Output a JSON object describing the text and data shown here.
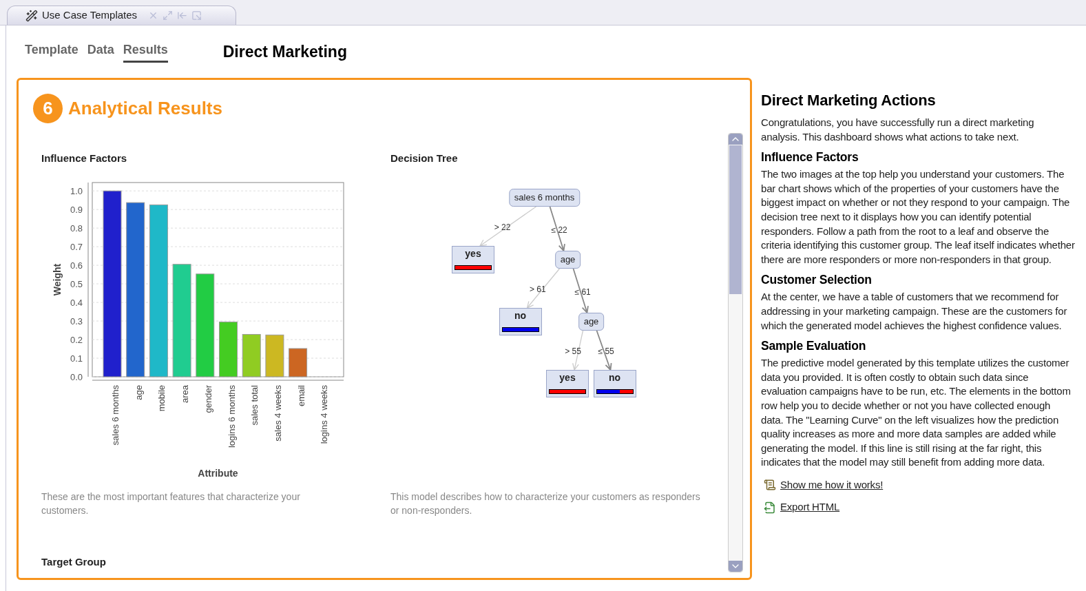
{
  "tab": {
    "title": "Use Case Templates"
  },
  "nav": [
    {
      "label": "Template",
      "selected": false
    },
    {
      "label": "Data",
      "selected": false
    },
    {
      "label": "Results",
      "selected": true
    }
  ],
  "page_title": "Direct Marketing",
  "results": {
    "step": "6",
    "title": "Analytical Results",
    "influence_factors": {
      "title": "Influence Factors",
      "caption": "These are the most important features that characterize your customers.",
      "chart_data": {
        "type": "bar",
        "xlabel": "Attribute",
        "ylabel": "Weight",
        "categories": [
          "sales 6 months",
          "age",
          "mobile",
          "area",
          "gender",
          "logins 6 months",
          "sales total",
          "sales 4 weeks",
          "email",
          "logins 4 weeks"
        ],
        "grid": true,
        "series": [
          {
            "values": [
              1.0,
              0.937,
              0.925,
              0.605,
              0.553,
              0.295,
              0.228,
              0.225,
              0.152,
              0.0
            ]
          }
        ],
        "colors": [
          "#2020cc",
          "#2266cc",
          "#1fb8c8",
          "#20cc90",
          "#22cc44",
          "#44cc22",
          "#90cc22",
          "#ccb822",
          "#cc6622"
        ],
        "ylim": [
          0,
          1.045
        ],
        "yticks": [
          {
            "value": 0,
            "label": "0.0"
          },
          {
            "value": 0.1,
            "label": "0.1"
          },
          {
            "value": 0.2,
            "label": "0.2"
          },
          {
            "value": 0.3,
            "label": "0.3"
          },
          {
            "value": 0.4,
            "label": "0.4"
          },
          {
            "value": 0.5,
            "label": "0.5"
          },
          {
            "value": 0.6,
            "label": "0.6"
          },
          {
            "value": 0.7,
            "label": "0.7"
          },
          {
            "value": 0.8,
            "label": "0.8"
          },
          {
            "value": 0.9,
            "label": "0.9"
          },
          {
            "value": 1.0,
            "label": "1.0"
          }
        ]
      }
    },
    "decision_tree": {
      "title": "Decision Tree",
      "caption": "This model describes how to characterize your customers as responders or non-responders.",
      "root": {
        "kind": "split",
        "label": "sales 6 months",
        "children": [
          {
            "edge": "> 22",
            "kind": "leaf",
            "label": "yes",
            "level": 0
          },
          {
            "edge": "≤ 22",
            "kind": "split",
            "label": "age",
            "children": [
              {
                "edge": "> 61",
                "kind": "leaf",
                "label": "no",
                "level": 1
              },
              {
                "edge": "≤ 61",
                "kind": "split",
                "label": "age",
                "children": [
                  {
                    "edge": "> 55",
                    "kind": "leaf",
                    "label": "yes",
                    "level": 0
                  },
                  {
                    "edge": "≤ 55",
                    "kind": "leaf",
                    "label": "no",
                    "level": 0.65
                  }
                ]
              }
            ]
          }
        ]
      }
    },
    "target_group": {
      "title": "Target Group"
    }
  },
  "actions": {
    "title": "Direct Marketing Actions",
    "intro": "Congratulations, you have successfully run a direct marketing analysis. This dashboard shows what actions to take next.",
    "sections": [
      {
        "heading": "Influence Factors",
        "body": "The two images at the top help you understand your customers. The bar chart shows which of the properties of your customers have the biggest impact on whether or not they respond to your campaign. The decision tree next to it displays how you can identify potential responders. Follow a path from the root to a leaf and observe the criteria identifying this customer group. The leaf itself indicates whether there are more responders or more non-responders in that group."
      },
      {
        "heading": "Customer Selection",
        "body": "At the center, we have a table of customers that we recommend for addressing in your marketing campaign. These are the customers for which the generated model achieves the highest confidence values."
      },
      {
        "heading": "Sample Evaluation",
        "body": "The predictive model generated by this template utilizes the customer data you provided. It is often costly to obtain such data since evaluation campaigns have to be run, etc. The elements in the bottom row help you to decide whether or not you have collected enough data. The \"Learning Curve\" on the left visualizes how the prediction quality increases as more and more data samples are added while generating the model. If this line is still rising at the far right, this indicates that the model may still benefit from adding more data."
      }
    ],
    "links": [
      {
        "kind": "help",
        "label": "Show me how it works!"
      },
      {
        "kind": "export",
        "label": "Export HTML"
      }
    ]
  }
}
